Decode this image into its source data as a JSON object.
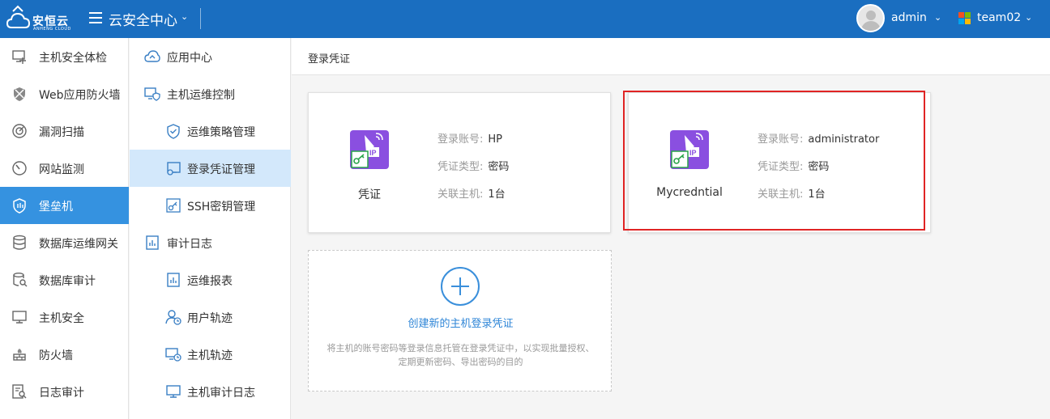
{
  "topbar": {
    "logo_text": "安恒云",
    "logo_sub": "ANHENG CLOUD",
    "app_title": "云安全中心",
    "user": "admin",
    "team": "team02",
    "caret": "⌄",
    "colors": {
      "bar": "#1a6ec0",
      "active": "#3592e0"
    }
  },
  "sidebar": {
    "items": [
      {
        "label": "主机安全体检",
        "icon": "host-check-icon"
      },
      {
        "label": "Web应用防火墙",
        "icon": "waf-shield-icon"
      },
      {
        "label": "漏洞扫描",
        "icon": "scan-icon"
      },
      {
        "label": "网站监测",
        "icon": "gauge-icon"
      },
      {
        "label": "堡垒机",
        "icon": "bastion-shield-icon",
        "active": true
      },
      {
        "label": "数据库运维网关",
        "icon": "database-icon"
      },
      {
        "label": "数据库审计",
        "icon": "database-search-icon"
      },
      {
        "label": "主机安全",
        "icon": "monitor-icon"
      },
      {
        "label": "防火墙",
        "icon": "firewall-icon"
      },
      {
        "label": "日志审计",
        "icon": "log-search-icon"
      }
    ]
  },
  "subnav": {
    "items": [
      {
        "label": "应用中心",
        "level": 1,
        "icon": "cloud-app-icon"
      },
      {
        "label": "主机运维控制",
        "level": 1,
        "icon": "host-shield-icon"
      },
      {
        "label": "运维策略管理",
        "level": 2,
        "icon": "shield-check-icon"
      },
      {
        "label": "登录凭证管理",
        "level": 2,
        "icon": "credential-icon",
        "active": true
      },
      {
        "label": "SSH密钥管理",
        "level": 2,
        "icon": "key-icon"
      },
      {
        "label": "审计日志",
        "level": 1,
        "icon": "audit-chart-icon"
      },
      {
        "label": "运维报表",
        "level": 2,
        "icon": "report-icon"
      },
      {
        "label": "用户轨迹",
        "level": 2,
        "icon": "user-clock-icon"
      },
      {
        "label": "主机轨迹",
        "level": 2,
        "icon": "host-clock-icon"
      },
      {
        "label": "主机审计日志",
        "level": 2,
        "icon": "monitor-log-icon"
      }
    ]
  },
  "main": {
    "title": "登录凭证",
    "labels": {
      "account": "登录账号:",
      "type": "凭证类型:",
      "hosts": "关联主机:"
    },
    "cards": [
      {
        "name": "凭证",
        "account": "HP",
        "type": "密码",
        "hosts": "1台"
      },
      {
        "name": "Mycredntial",
        "account": "administrator",
        "type": "密码",
        "hosts": "1台"
      }
    ],
    "new_card": {
      "title": "创建新的主机登录凭证",
      "desc": "将主机的账号密码等登录信息托管在登录凭证中，以实现批量授权、定期更新密码、导出密码的目的"
    }
  }
}
